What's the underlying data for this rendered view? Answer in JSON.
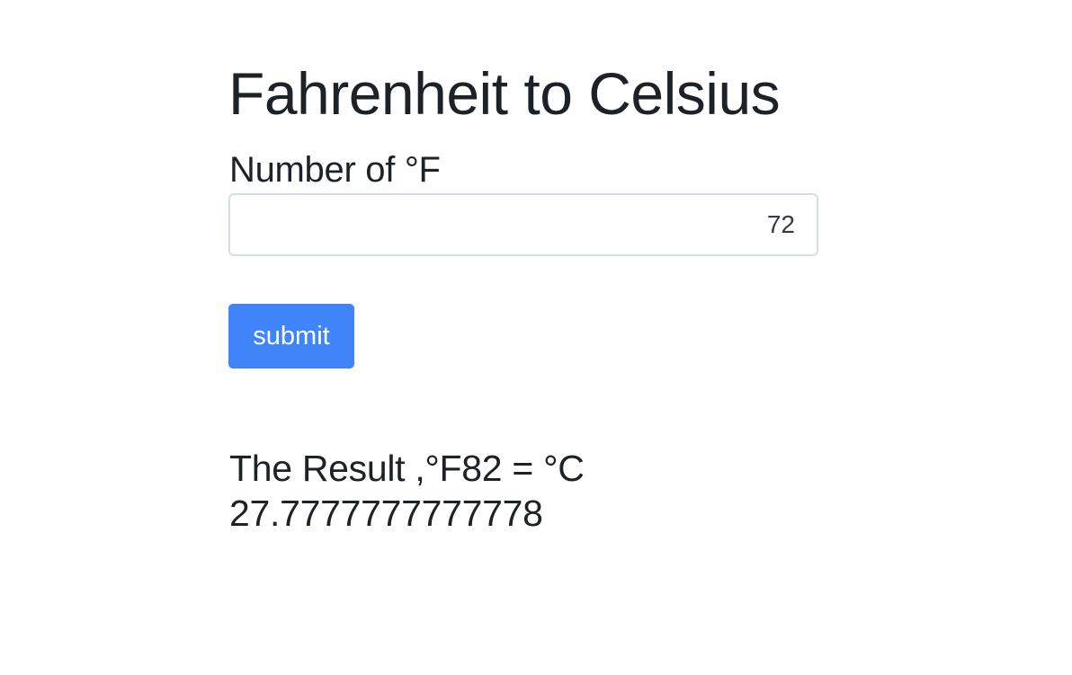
{
  "page": {
    "title": "Fahrenheit to Celsius"
  },
  "form": {
    "label": "Number of °F",
    "input_value": "72",
    "submit_label": "submit"
  },
  "result": {
    "line1": "The Result ,°F82 = °C",
    "line2": "27.7777777777778"
  },
  "colors": {
    "button_background": "#3f84f8",
    "button_text": "#ffffff",
    "text": "#1c2227",
    "input_border": "#d6dee5"
  }
}
